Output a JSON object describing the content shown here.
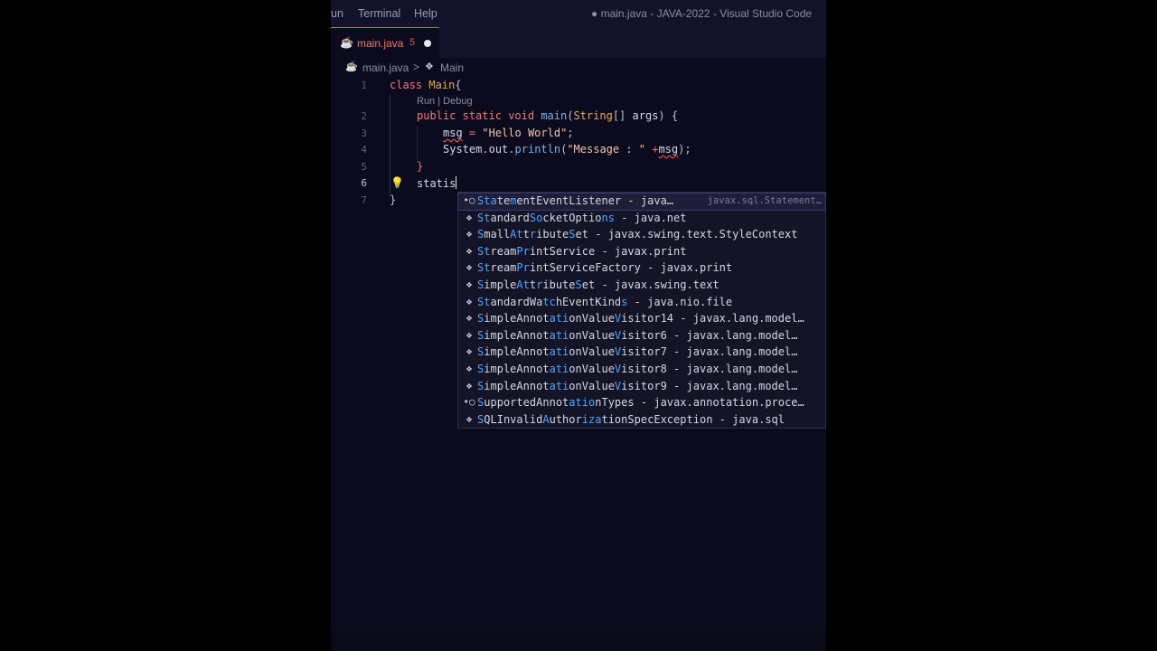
{
  "menubar": {
    "items": [
      "un",
      "Terminal",
      "Help"
    ],
    "window_title": "● main.java - JAVA-2022 - Visual Studio Code"
  },
  "tab": {
    "name": "main.java",
    "count": "5",
    "icon": "java-file-icon"
  },
  "breadcrumb": {
    "file": "main.java",
    "separator": ">",
    "symbol": "Main"
  },
  "codelens": "Run | Debug",
  "code": {
    "line_numbers": [
      "1",
      "2",
      "3",
      "4",
      "5",
      "6",
      "7"
    ],
    "active_line": "6",
    "typed_word": "statis",
    "lines": [
      [
        {
          "t": "class",
          "c": "kw"
        },
        {
          "t": " ",
          "c": "pn"
        },
        {
          "t": "Main",
          "c": "ty"
        },
        {
          "t": "{",
          "c": "pn"
        }
      ],
      [
        {
          "t": "public",
          "c": "kw"
        },
        {
          "t": " ",
          "c": "pn"
        },
        {
          "t": "static",
          "c": "kw"
        },
        {
          "t": " ",
          "c": "pn"
        },
        {
          "t": "void",
          "c": "kw"
        },
        {
          "t": " ",
          "c": "pn"
        },
        {
          "t": "main",
          "c": "fn"
        },
        {
          "t": "(",
          "c": "pn"
        },
        {
          "t": "String",
          "c": "ty"
        },
        {
          "t": "[] ",
          "c": "pn"
        },
        {
          "t": "args",
          "c": "vr"
        },
        {
          "t": ") {",
          "c": "pn"
        }
      ],
      [
        {
          "t": "msg",
          "c": "vr err"
        },
        {
          "t": " = ",
          "c": "kw"
        },
        {
          "t": "\"Hello World\"",
          "c": "st"
        },
        {
          "t": ";",
          "c": "pn"
        }
      ],
      [
        {
          "t": "System",
          "c": "vr"
        },
        {
          "t": ".",
          "c": "pn"
        },
        {
          "t": "out",
          "c": "vr"
        },
        {
          "t": ".",
          "c": "pn"
        },
        {
          "t": "println",
          "c": "fn"
        },
        {
          "t": "(",
          "c": "pn"
        },
        {
          "t": "\"Message : \"",
          "c": "st"
        },
        {
          "t": " +",
          "c": "kw"
        },
        {
          "t": "msg",
          "c": "vr err"
        },
        {
          "t": ");",
          "c": "pn"
        }
      ],
      [
        {
          "t": "}",
          "c": "kw"
        }
      ],
      [],
      [
        {
          "t": "}",
          "c": "pn"
        }
      ]
    ]
  },
  "suggestions": [
    {
      "icon": "•○",
      "label": "StatementEventListener - java…",
      "hl": [
        0,
        1,
        2,
        5
      ],
      "detail": "javax.sql.Statement…",
      "selected": true
    },
    {
      "icon": "❖",
      "label": "StandardSocketOptions - java.net",
      "hl": [
        0,
        1,
        8,
        9,
        19,
        20
      ]
    },
    {
      "icon": "❖",
      "label": "SmallAttributeSet - javax.swing.text.StyleContext",
      "hl": [
        0,
        5,
        6,
        8,
        14
      ]
    },
    {
      "icon": "❖",
      "label": "StreamPrintService - javax.print",
      "hl": [
        0,
        1,
        6,
        7
      ]
    },
    {
      "icon": "❖",
      "label": "StreamPrintServiceFactory - javax.print",
      "hl": [
        0,
        1,
        6,
        7
      ]
    },
    {
      "icon": "❖",
      "label": "SimpleAttributeSet - javax.swing.text",
      "hl": [
        0,
        6,
        7,
        9,
        15
      ]
    },
    {
      "icon": "❖",
      "label": "StandardWatchEventKinds - java.nio.file",
      "hl": [
        0,
        1,
        10,
        11,
        22
      ]
    },
    {
      "icon": "❖",
      "label": "SimpleAnnotationValueVisitor14 - javax.lang.model…",
      "hl": [
        0,
        11,
        12,
        13,
        21
      ]
    },
    {
      "icon": "❖",
      "label": "SimpleAnnotationValueVisitor6 - javax.lang.model…",
      "hl": [
        0,
        11,
        12,
        13,
        21
      ]
    },
    {
      "icon": "❖",
      "label": "SimpleAnnotationValueVisitor7 - javax.lang.model…",
      "hl": [
        0,
        11,
        12,
        13,
        21
      ]
    },
    {
      "icon": "❖",
      "label": "SimpleAnnotationValueVisitor8 - javax.lang.model…",
      "hl": [
        0,
        11,
        12,
        13,
        21
      ]
    },
    {
      "icon": "❖",
      "label": "SimpleAnnotationValueVisitor9 - javax.lang.model…",
      "hl": [
        0,
        11,
        12,
        13,
        21
      ]
    },
    {
      "icon": "•○",
      "label": "SupportedAnnotationTypes - javax.annotation.proce…",
      "hl": [
        0,
        14,
        15,
        16,
        17
      ]
    },
    {
      "icon": "❖",
      "label": "SQLInvalidAuthorizationSpecException - java.sql",
      "hl": [
        0,
        10,
        16,
        17,
        18
      ]
    }
  ]
}
